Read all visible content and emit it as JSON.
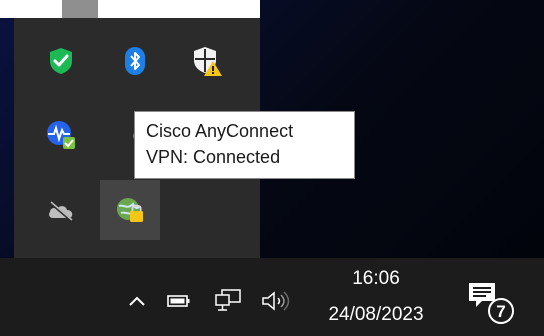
{
  "tooltip": {
    "line1": "Cisco AnyConnect",
    "line2": "VPN: Connected"
  },
  "tray_icons": [
    {
      "name": "windows-security-icon",
      "color": "#1db954"
    },
    {
      "name": "bluetooth-icon",
      "color": "#1e7fe6"
    },
    {
      "name": "security-shield-warning-icon",
      "color": "#f5c518"
    },
    {
      "name": "activity-monitor-icon",
      "color": "#3b82f6"
    },
    {
      "name": "partial-circle-icon",
      "color": "#cfcfcf"
    },
    {
      "name": "onedrive-offline-icon",
      "color": "#bdbdbd"
    },
    {
      "name": "cisco-anyconnect-vpn-icon",
      "color": "#f5c518"
    }
  ],
  "taskbar": {
    "time": "16:06",
    "date": "24/08/2023",
    "notification_count": "7",
    "icons": [
      "show-hidden-icons-icon",
      "battery-icon",
      "network-icon",
      "volume-icon",
      "action-center-icon"
    ]
  }
}
